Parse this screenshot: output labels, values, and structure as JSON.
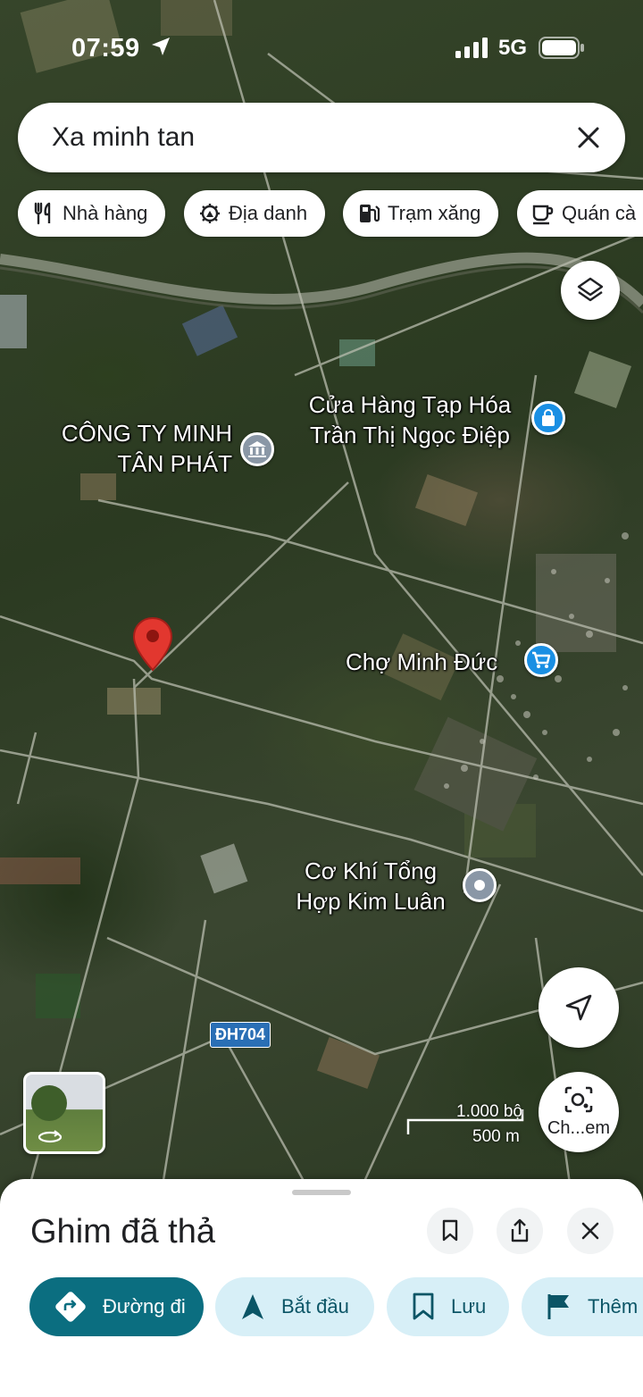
{
  "status_bar": {
    "time": "07:59",
    "network": "5G"
  },
  "search": {
    "value": "Xa minh tan"
  },
  "chips": [
    {
      "label": "Nhà hàng",
      "icon": "fork-knife-icon"
    },
    {
      "label": "Địa danh",
      "icon": "landmark-icon"
    },
    {
      "label": "Trạm xăng",
      "icon": "gas-station-icon"
    },
    {
      "label": "Quán cà",
      "icon": "coffee-icon"
    }
  ],
  "map": {
    "labels": {
      "cong_ty": [
        "CÔNG TY MINH",
        "TÂN PHÁT"
      ],
      "cua_hang": [
        "Cửa Hàng Tạp Hóa",
        "Trần Thị Ngọc Điệp"
      ],
      "cho": [
        "Chợ Minh Đức"
      ],
      "co_khi": [
        "Cơ Khí Tổng",
        "Hợp Kim Luân"
      ]
    },
    "road_shield": "ĐH704",
    "scale": {
      "feet": "1.000 bộ",
      "meters": "500 m"
    },
    "lens_label": "Ch...em",
    "colors": {
      "pin": "#e2372f",
      "shop": "#1a8fe3",
      "gray_poi": "#8a97a6"
    }
  },
  "sheet": {
    "title": "Ghim đã thả",
    "actions": [
      {
        "label": "Đường đi",
        "style": "primary"
      },
      {
        "label": "Bắt đầu",
        "style": "tonal"
      },
      {
        "label": "Lưu",
        "style": "tonal"
      },
      {
        "label": "Thêm",
        "style": "tonal"
      }
    ]
  }
}
